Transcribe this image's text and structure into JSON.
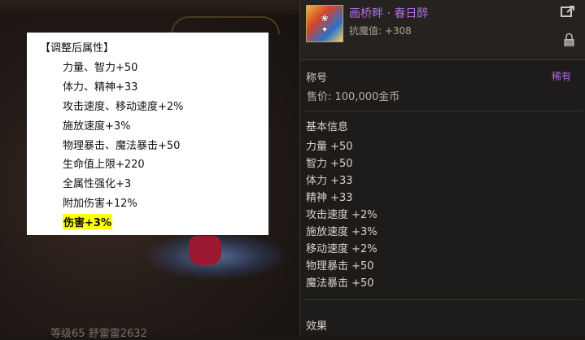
{
  "attributes_popup": {
    "title": "【调整后属性】",
    "lines": [
      "力量、智力+50",
      "体力、精神+33",
      "攻击速度、移动速度+2%",
      "施放速度+3%",
      "物理暴击、魔法暴击+50",
      "生命值上限+220",
      "全属性强化+3",
      "附加伤害+12%",
      "伤害+3%"
    ],
    "highlight_color": "#ffff00"
  },
  "item": {
    "name": "画桥畔 · 春日醉",
    "resist": "抗魔值: +308",
    "type_label": "称号",
    "rarity": "稀有",
    "price": "售价: 100,000金币",
    "basic_info_label": "基本信息",
    "stats": [
      "力量 +50",
      "智力 +50",
      "体力 +33",
      "精神 +33",
      "攻击速度 +2%",
      "施放速度 +3%",
      "移动速度 +2%",
      "物理暴击 +50",
      "魔法暴击 +50"
    ],
    "effect_label": "效果",
    "name_color": "#b26ee0",
    "share_icon": "share-icon",
    "lock_icon": "lock-icon"
  },
  "background": {
    "caption": "等级65 舒雷雷2632"
  }
}
